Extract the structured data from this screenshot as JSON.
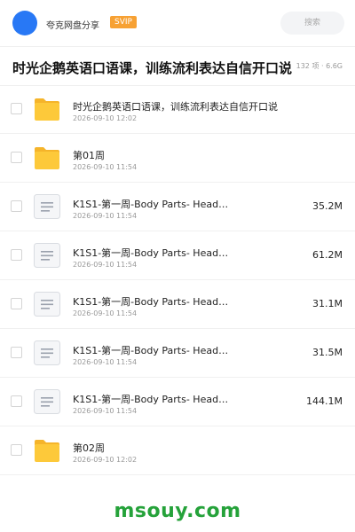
{
  "header": {
    "share_title": "夸克网盘分享",
    "vip_badge": "SVIP",
    "search_placeholder": "搜索",
    "avatar_color": "#2878f5"
  },
  "folder": {
    "title": "时光企鹅英语口语课，训练流利表达自信开口说",
    "meta": "132 项 · 6.6G"
  },
  "files": [
    {
      "type": "folder",
      "name": "时光企鹅英语口语课，训练流利表达自信开口说",
      "date": "2026-09-10 12:02",
      "size": ""
    },
    {
      "type": "folder",
      "name": "第01周",
      "date": "2026-09-10 11:54",
      "size": ""
    },
    {
      "type": "doc",
      "name": "K1S1-第一周-Body Parts- Head…",
      "date": "2026-09-10 11:54",
      "size": "35.2M"
    },
    {
      "type": "doc",
      "name": "K1S1-第一周-Body Parts- Head…",
      "date": "2026-09-10 11:54",
      "size": "61.2M"
    },
    {
      "type": "doc",
      "name": "K1S1-第一周-Body Parts- Head…",
      "date": "2026-09-10 11:54",
      "size": "31.1M"
    },
    {
      "type": "doc",
      "name": "K1S1-第一周-Body Parts- Head…",
      "date": "2026-09-10 11:54",
      "size": "31.5M"
    },
    {
      "type": "doc",
      "name": "K1S1-第一周-Body Parts- Head…",
      "date": "2026-09-10 11:54",
      "size": "144.1M"
    },
    {
      "type": "folder",
      "name": "第02周",
      "date": "2026-09-10 12:02",
      "size": ""
    }
  ],
  "footer": {
    "watermark": "msouy.com",
    "watermark_color": "#25a23a"
  },
  "colors": {
    "accent": "#2878f5",
    "vip": "#f7a133",
    "folder": "#fbc02d"
  }
}
